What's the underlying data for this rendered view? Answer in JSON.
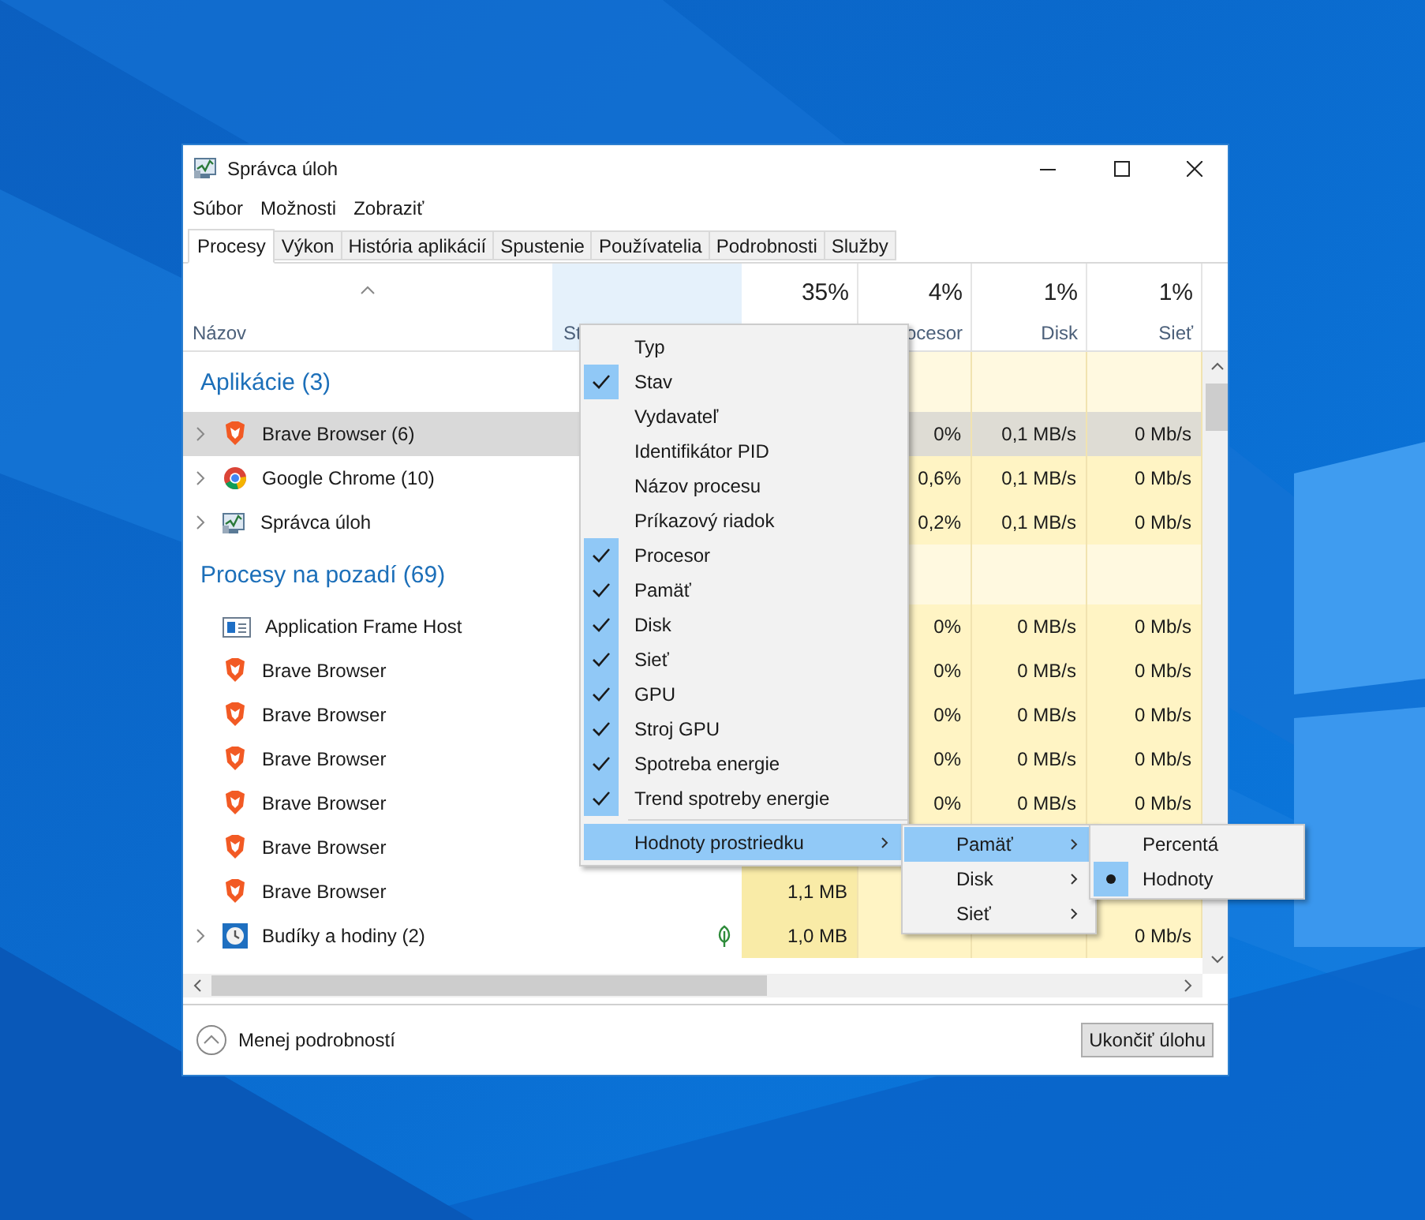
{
  "window": {
    "title": "Správca úloh"
  },
  "menu_bar": [
    "Súbor",
    "Možnosti",
    "Zobraziť"
  ],
  "tabs": [
    {
      "label": "Procesy",
      "selected": true
    },
    {
      "label": "Výkon",
      "selected": false
    },
    {
      "label": "História aplikácií",
      "selected": false
    },
    {
      "label": "Spustenie",
      "selected": false
    },
    {
      "label": "Používatelia",
      "selected": false
    },
    {
      "label": "Podrobnosti",
      "selected": false
    },
    {
      "label": "Služby",
      "selected": false
    }
  ],
  "columns": [
    {
      "label": "Názov",
      "sorted": true,
      "highlighted": false
    },
    {
      "label": "St",
      "sorted": false,
      "highlighted": true
    },
    {
      "value": "35%",
      "sorted": false,
      "highlighted": false
    },
    {
      "value": "4%",
      "label": "ocesor",
      "sorted": false,
      "highlighted": false
    },
    {
      "value": "1%",
      "label": "Disk",
      "sorted": false,
      "highlighted": false
    },
    {
      "value": "1%",
      "label": "Sieť",
      "sorted": false,
      "highlighted": false
    }
  ],
  "rows": [
    {
      "kind": "group",
      "label": "Aplikácie (3)"
    },
    {
      "kind": "brave",
      "name": "Brave Browser (6)",
      "expandable": true,
      "selected": true,
      "cells": [
        null,
        "0%",
        "0,1 MB/s",
        "0 Mb/s"
      ]
    },
    {
      "kind": "chrome",
      "name": "Google Chrome (10)",
      "expandable": true,
      "selected": false,
      "cells": [
        null,
        "0,6%",
        "0,1 MB/s",
        "0 Mb/s"
      ]
    },
    {
      "kind": "taskmgr",
      "name": "Správca úloh",
      "expandable": true,
      "selected": false,
      "cells": [
        null,
        "0,2%",
        "0,1 MB/s",
        "0 Mb/s"
      ]
    },
    {
      "kind": "group",
      "label": "Procesy na pozadí (69)"
    },
    {
      "kind": "appframe",
      "name": "Application Frame Host",
      "expandable": false,
      "selected": false,
      "cells": [
        null,
        "0%",
        "0 MB/s",
        "0 Mb/s"
      ]
    },
    {
      "kind": "brave",
      "name": "Brave Browser",
      "expandable": false,
      "selected": false,
      "cells": [
        null,
        "0%",
        "0 MB/s",
        "0 Mb/s"
      ]
    },
    {
      "kind": "brave",
      "name": "Brave Browser",
      "expandable": false,
      "selected": false,
      "cells": [
        null,
        "0%",
        "0 MB/s",
        "0 Mb/s"
      ]
    },
    {
      "kind": "brave",
      "name": "Brave Browser",
      "expandable": false,
      "selected": false,
      "cells": [
        null,
        "0%",
        "0 MB/s",
        "0 Mb/s"
      ]
    },
    {
      "kind": "brave",
      "name": "Brave Browser",
      "expandable": false,
      "selected": false,
      "cells": [
        null,
        "0%",
        "0 MB/s",
        "0 Mb/s"
      ]
    },
    {
      "kind": "brave",
      "name": "Brave Browser",
      "expandable": false,
      "selected": false,
      "cells": [
        null,
        null,
        null,
        null
      ]
    },
    {
      "kind": "brave",
      "name": "Brave Browser",
      "expandable": false,
      "selected": false,
      "cells": [
        "1,1 MB",
        null,
        null,
        null
      ]
    },
    {
      "kind": "clock",
      "name": "Budíky a hodiny (2)",
      "expandable": true,
      "selected": false,
      "eco": true,
      "cells": [
        "1,0 MB",
        null,
        null,
        "0 Mb/s"
      ]
    }
  ],
  "context_menu": {
    "items": [
      {
        "kind": "check",
        "label": "Typ",
        "checked": false
      },
      {
        "kind": "check",
        "label": "Stav",
        "checked": true
      },
      {
        "kind": "check",
        "label": "Vydavateľ",
        "checked": false
      },
      {
        "kind": "check",
        "label": "Identifikátor PID",
        "checked": false
      },
      {
        "kind": "check",
        "label": "Názov procesu",
        "checked": false
      },
      {
        "kind": "check",
        "label": "Príkazový riadok",
        "checked": false
      },
      {
        "kind": "check",
        "label": "Procesor",
        "checked": true
      },
      {
        "kind": "check",
        "label": "Pamäť",
        "checked": true
      },
      {
        "kind": "check",
        "label": "Disk",
        "checked": true
      },
      {
        "kind": "check",
        "label": "Sieť",
        "checked": true
      },
      {
        "kind": "check",
        "label": "GPU",
        "checked": true
      },
      {
        "kind": "check",
        "label": "Stroj GPU",
        "checked": true
      },
      {
        "kind": "check",
        "label": "Spotreba energie",
        "checked": true
      },
      {
        "kind": "check",
        "label": "Trend spotreby energie",
        "checked": true
      },
      {
        "kind": "submenu",
        "label": "Hodnoty prostriedku",
        "expanded": true
      }
    ]
  },
  "submenu": {
    "items": [
      {
        "label": "Pamäť",
        "expanded": true
      },
      {
        "label": "Disk",
        "expanded": false
      },
      {
        "label": "Sieť",
        "expanded": false
      }
    ]
  },
  "submenu_2": {
    "items": [
      {
        "label": "Percentá",
        "selected": false
      },
      {
        "label": "Hodnoty",
        "selected": true
      }
    ]
  },
  "footer": {
    "details_link": "Menej podrobností",
    "end_task_button": "Ukončiť úlohu"
  }
}
